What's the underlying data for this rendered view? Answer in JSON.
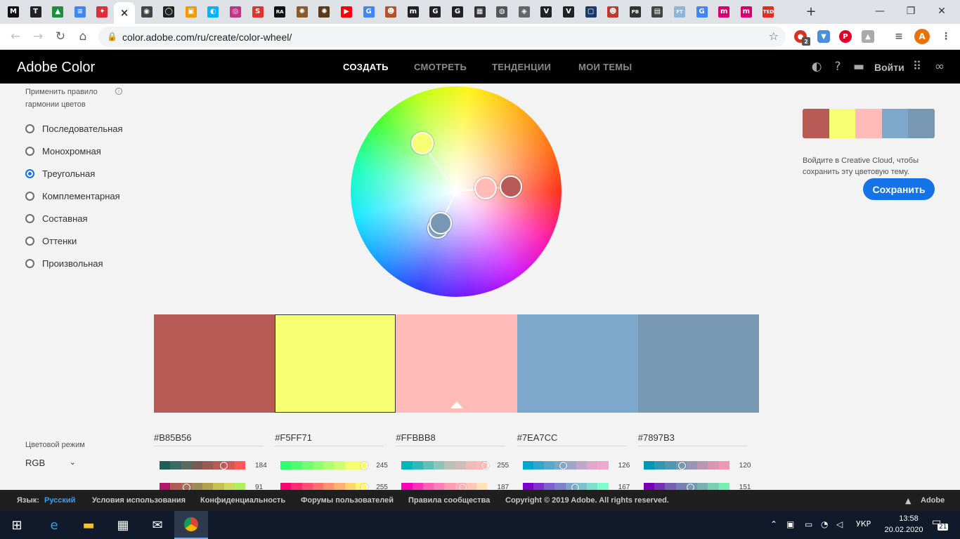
{
  "browser": {
    "tabs": [
      {
        "icon": "M",
        "color": "#111111"
      },
      {
        "icon": "T",
        "color": "#222222"
      },
      {
        "icon": "▲",
        "color": "#1e8e3e"
      },
      {
        "icon": "≡",
        "color": "#4285f4"
      },
      {
        "icon": "✦",
        "color": "#d9303a"
      },
      {
        "icon": "×",
        "color": "#ffffff",
        "active": true
      },
      {
        "icon": "◉",
        "color": "#444444"
      },
      {
        "icon": "◯",
        "color": "#222222"
      },
      {
        "icon": "▣",
        "color": "#f29900"
      },
      {
        "icon": "◐",
        "color": "#00b2ff"
      },
      {
        "icon": "◎",
        "color": "#c13584"
      },
      {
        "icon": "S",
        "color": "#e0332b"
      },
      {
        "icon": "RA",
        "color": "#111111"
      },
      {
        "icon": "✺",
        "color": "#8a5a2b"
      },
      {
        "icon": "✺",
        "color": "#5a3a1a"
      },
      {
        "icon": "▶",
        "color": "#ff0000"
      },
      {
        "icon": "G",
        "color": "#4285f4"
      },
      {
        "icon": "☻",
        "color": "#b4532a"
      },
      {
        "icon": "m",
        "color": "#222222"
      },
      {
        "icon": "G",
        "color": "#222222"
      },
      {
        "icon": "G",
        "color": "#222222"
      },
      {
        "icon": "▦",
        "color": "#333333"
      },
      {
        "icon": "◍",
        "color": "#555555"
      },
      {
        "icon": "◈",
        "color": "#666666"
      },
      {
        "icon": "V",
        "color": "#222222"
      },
      {
        "icon": "V",
        "color": "#222222"
      },
      {
        "icon": "▢",
        "color": "#1a3a6a"
      },
      {
        "icon": "☻",
        "color": "#c0392b"
      },
      {
        "icon": "PB",
        "color": "#333333"
      },
      {
        "icon": "▤",
        "color": "#444444"
      },
      {
        "icon": "FT",
        "color": "#8fb3d9"
      },
      {
        "icon": "G",
        "color": "#4285f4"
      },
      {
        "icon": "m",
        "color": "#d5006d"
      },
      {
        "icon": "m",
        "color": "#d5006d"
      },
      {
        "icon": "TED",
        "color": "#e62b1e"
      }
    ],
    "new_tab": "+",
    "minimize": "—",
    "restore": "❐",
    "close": "✕",
    "url": "color.adobe.com/ru/create/color-wheel/",
    "ext_badge": "2",
    "profile_initial": "A"
  },
  "header": {
    "brand": "Adobe Color",
    "nav": [
      {
        "label": "СОЗДАТЬ",
        "active": true
      },
      {
        "label": "СМОТРЕТЬ",
        "active": false
      },
      {
        "label": "ТЕНДЕНЦИИ",
        "active": false
      },
      {
        "label": "МОИ ТЕМЫ",
        "active": false
      }
    ],
    "signin": "Войти"
  },
  "harmony": {
    "title": "Применить правило гармонии цветов",
    "options": [
      {
        "label": "Последовательная",
        "checked": false
      },
      {
        "label": "Монохромная",
        "checked": false
      },
      {
        "label": "Треугольная",
        "checked": true
      },
      {
        "label": "Комплементарная",
        "checked": false
      },
      {
        "label": "Составная",
        "checked": false
      },
      {
        "label": "Оттенки",
        "checked": false
      },
      {
        "label": "Произвольная",
        "checked": false
      }
    ]
  },
  "theme": {
    "colors": [
      "#B85B56",
      "#F5FF71",
      "#FFBBB8",
      "#7EA7CC",
      "#7897B3"
    ],
    "base_index": 2,
    "selected_index": 1
  },
  "save": {
    "message": "Войдите в Creative Cloud, чтобы сохранить эту цветовую тему.",
    "button": "Сохранить"
  },
  "color_mode": {
    "label": "Цветовой режим",
    "value": "RGB"
  },
  "sliders": [
    {
      "r": "184",
      "g": "91"
    },
    {
      "r": "245",
      "g": "255"
    },
    {
      "r": "255",
      "g": "187"
    },
    {
      "r": "126",
      "g": "167"
    },
    {
      "r": "120",
      "g": "151"
    }
  ],
  "footer": {
    "lang_label": "Язык:",
    "lang_value": "Русский",
    "links": [
      "Условия использования",
      "Конфиденциальность",
      "Форумы пользователей",
      "Правила сообщества"
    ],
    "copyright": "Copyright © 2019 Adobe. All rights reserved.",
    "adobe": "Adobe"
  },
  "taskbar": {
    "lang": "УКР",
    "time": "13:58",
    "date": "20.02.2020",
    "notifications": "21"
  }
}
